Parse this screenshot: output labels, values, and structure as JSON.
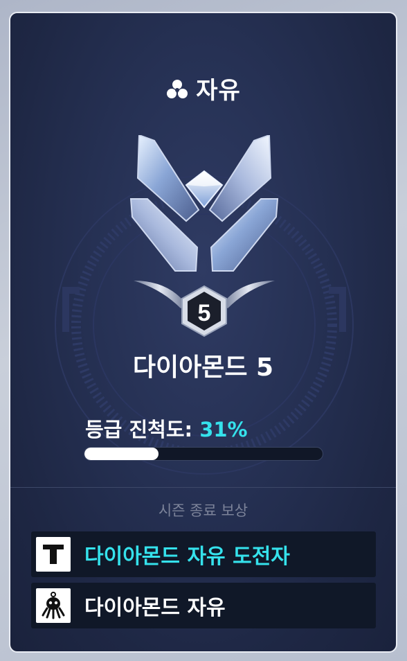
{
  "mode": {
    "icon": "three-circles-icon",
    "title": "자유"
  },
  "rank": {
    "emblem": "diamond-emblem",
    "division_number": "5",
    "tier_name": "다이아몬드 5"
  },
  "progress": {
    "label": "등급 진척도:",
    "percent_text": "31%",
    "value": 0.31
  },
  "rewards": {
    "title": "시즌 종료 보상",
    "items": [
      {
        "icon": "title-t-icon",
        "label": "다이아몬드 자유 도전자",
        "color": "#35e2ec"
      },
      {
        "icon": "octopus-icon",
        "label": "다이아몬드 자유",
        "color": "#ffffff"
      }
    ]
  },
  "colors": {
    "accent": "#35e2ec",
    "card_bg": "#263154"
  }
}
